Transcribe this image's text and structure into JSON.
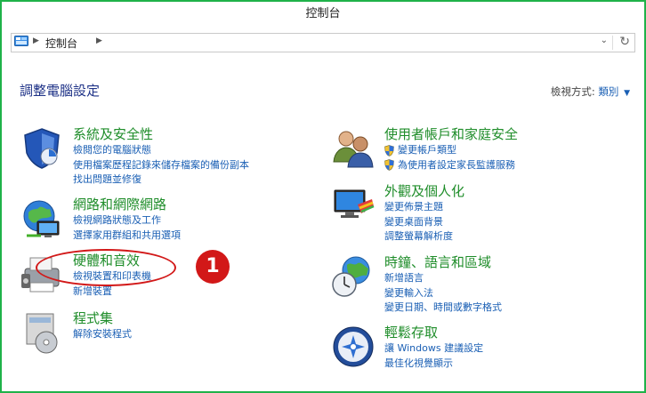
{
  "window": {
    "title": "控制台"
  },
  "address": {
    "path": "控制台"
  },
  "header": {
    "title": "調整電腦設定",
    "view_label": "檢視方式:",
    "view_value": "類別"
  },
  "left": [
    {
      "title": "系統及安全性",
      "links": [
        "檢閱您的電腦狀態",
        "使用檔案歷程記錄來儲存檔案的備份副本",
        "找出問題並修復"
      ]
    },
    {
      "title": "網路和網際網路",
      "links": [
        "檢視網路狀態及工作",
        "選擇家用群組和共用選項"
      ]
    },
    {
      "title": "硬體和音效",
      "links": [
        "檢視裝置和印表機",
        "新增裝置"
      ]
    },
    {
      "title": "程式集",
      "links": [
        "解除安裝程式"
      ]
    }
  ],
  "right": [
    {
      "title": "使用者帳戶和家庭安全",
      "links": [
        "變更帳戶類型",
        "為使用者設定家長監護服務"
      ]
    },
    {
      "title": "外觀及個人化",
      "links": [
        "變更佈景主題",
        "變更桌面背景",
        "調整螢幕解析度"
      ]
    },
    {
      "title": "時鐘、語言和區域",
      "links": [
        "新增語言",
        "變更輸入法",
        "變更日期、時間或數字格式"
      ]
    },
    {
      "title": "輕鬆存取",
      "links": [
        "讓 Windows 建議設定",
        "最佳化視覺顯示"
      ]
    }
  ],
  "annotation": {
    "step": "1"
  },
  "colors": {
    "frame": "#1fb24a",
    "category_title": "#1f8d2a",
    "link": "#1a5fb4",
    "heading": "#1e3287",
    "marker": "#d21818"
  }
}
